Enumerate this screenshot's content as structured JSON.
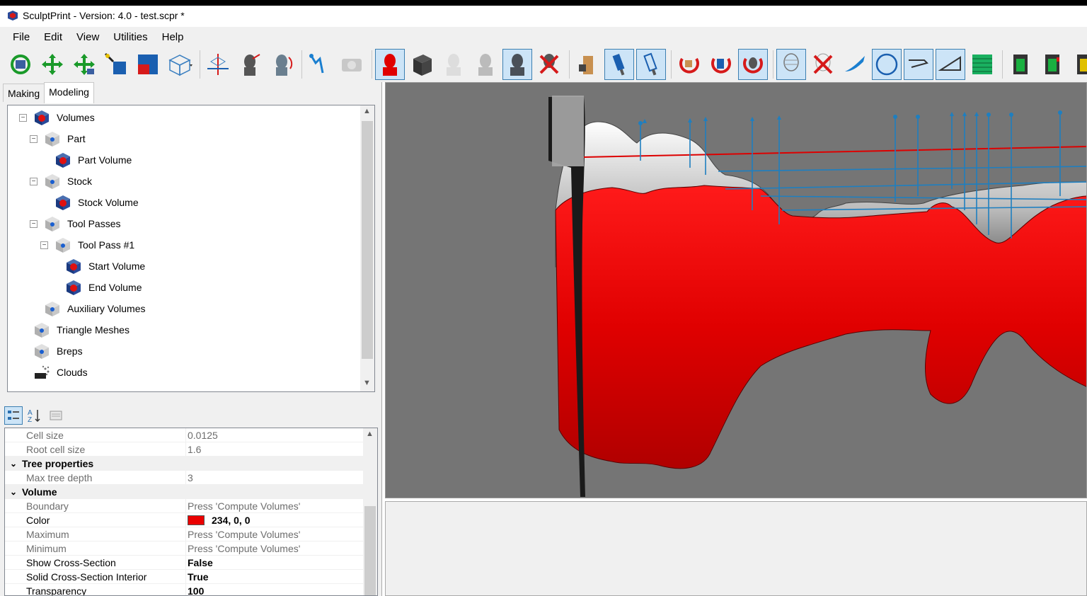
{
  "window": {
    "title": "SculptPrint - Version: 4.0 - test.scpr *"
  },
  "menu": [
    "File",
    "Edit",
    "View",
    "Utilities",
    "Help"
  ],
  "toolbar": {
    "buttons": [
      {
        "icon": "rotate-view-icon",
        "active": false
      },
      {
        "icon": "pan-view-icon",
        "active": false
      },
      {
        "icon": "move-view-icon",
        "active": false
      },
      {
        "icon": "zoom-view-icon",
        "active": false
      },
      {
        "icon": "fit-view-icon",
        "active": false
      },
      {
        "icon": "view-cube-dropdown-icon",
        "active": false
      },
      {
        "icon": "axis-transform-icon",
        "active": false
      },
      {
        "icon": "head-transform-icon",
        "active": false
      },
      {
        "icon": "head-rotate-icon",
        "active": false
      },
      {
        "icon": "tree-branch-icon",
        "active": false
      },
      {
        "icon": "camera-disabled-icon",
        "active": false
      },
      {
        "icon": "head-red-icon",
        "active": true
      },
      {
        "icon": "solid-cube-icon",
        "active": false
      },
      {
        "icon": "head-white-icon",
        "active": false
      },
      {
        "icon": "head-grey-icon",
        "active": false
      },
      {
        "icon": "head-dark-icon",
        "active": true
      },
      {
        "icon": "head-delete-icon",
        "active": false
      },
      {
        "icon": "hand-tool-icon",
        "active": false
      },
      {
        "icon": "tool-bit-icon",
        "active": true
      },
      {
        "icon": "tool-holder-icon",
        "active": true
      },
      {
        "icon": "rotate-red-icon",
        "active": false
      },
      {
        "icon": "rotate-red-blue-icon",
        "active": false
      },
      {
        "icon": "rotate-head-icon",
        "active": true
      },
      {
        "icon": "mesh-head-icon",
        "active": true
      },
      {
        "icon": "delete-mesh-icon",
        "active": false
      },
      {
        "icon": "blade-icon",
        "active": false
      },
      {
        "icon": "circle-icon",
        "active": true
      },
      {
        "icon": "line-tool-icon",
        "active": true
      },
      {
        "icon": "angle-tool-icon",
        "active": true
      },
      {
        "icon": "layers-icon",
        "active": false
      },
      {
        "icon": "green-box-icon",
        "active": false
      },
      {
        "icon": "green-box-2-icon",
        "active": false
      },
      {
        "icon": "yellow-box-icon",
        "active": false
      }
    ]
  },
  "left_panel": {
    "tabs": [
      {
        "label": "Making",
        "selected": false
      },
      {
        "label": "Modeling",
        "selected": true
      }
    ],
    "tree": [
      {
        "label": "Volumes",
        "level": 0,
        "expander": "⊟",
        "icon": "volume-cube-icon"
      },
      {
        "label": "Part",
        "level": 1,
        "expander": "⊟",
        "icon": "folder-cube-icon"
      },
      {
        "label": "Part Volume",
        "level": 2,
        "expander": "",
        "icon": "volume-cube-icon"
      },
      {
        "label": "Stock",
        "level": 1,
        "expander": "⊟",
        "icon": "folder-cube-icon"
      },
      {
        "label": "Stock Volume",
        "level": 2,
        "expander": "",
        "icon": "volume-cube-icon"
      },
      {
        "label": "Tool Passes",
        "level": 1,
        "expander": "⊟",
        "icon": "folder-cube-icon"
      },
      {
        "label": "Tool Pass #1",
        "level": 2,
        "expander": "⊟",
        "icon": "folder-cube-icon"
      },
      {
        "label": "Start Volume",
        "level": 3,
        "expander": "",
        "icon": "volume-cube-icon"
      },
      {
        "label": "End Volume",
        "level": 3,
        "expander": "",
        "icon": "volume-cube-icon"
      },
      {
        "label": "Auxiliary Volumes",
        "level": 1,
        "expander": "",
        "icon": "folder-cube-icon"
      },
      {
        "label": "Triangle Meshes",
        "level": 0,
        "expander": "",
        "icon": "folder-cube-icon"
      },
      {
        "label": "Breps",
        "level": 0,
        "expander": "",
        "icon": "folder-cube-icon"
      },
      {
        "label": "Clouds",
        "level": 0,
        "expander": "",
        "icon": "cloud-icon"
      }
    ],
    "properties": [
      {
        "type": "row",
        "name": "Cell size",
        "value": "0.0125",
        "readonly": true
      },
      {
        "type": "row",
        "name": "Root cell size",
        "value": "1.6",
        "readonly": true
      },
      {
        "type": "category",
        "name": "Tree properties"
      },
      {
        "type": "row",
        "name": "Max tree depth",
        "value": "3",
        "readonly": true
      },
      {
        "type": "category",
        "name": "Volume"
      },
      {
        "type": "row",
        "name": "Boundary",
        "value": "Press 'Compute Volumes'",
        "readonly": true
      },
      {
        "type": "color",
        "name": "Color",
        "value": "234, 0, 0",
        "color": "#ea0000"
      },
      {
        "type": "row",
        "name": "Maximum",
        "value": "Press 'Compute Volumes'",
        "readonly": true
      },
      {
        "type": "row",
        "name": "Minimum",
        "value": "Press 'Compute Volumes'",
        "readonly": true
      },
      {
        "type": "row",
        "name": "Show Cross-Section",
        "value": "False",
        "readonly": false
      },
      {
        "type": "row",
        "name": "Solid Cross-Section Interior",
        "value": "True",
        "readonly": false
      },
      {
        "type": "row",
        "name": "Transparency",
        "value": "100",
        "readonly": false
      }
    ]
  },
  "colors": {
    "accent": "#3c7fb1",
    "part_red": "#ea0000",
    "viewport_bg": "#757575"
  }
}
